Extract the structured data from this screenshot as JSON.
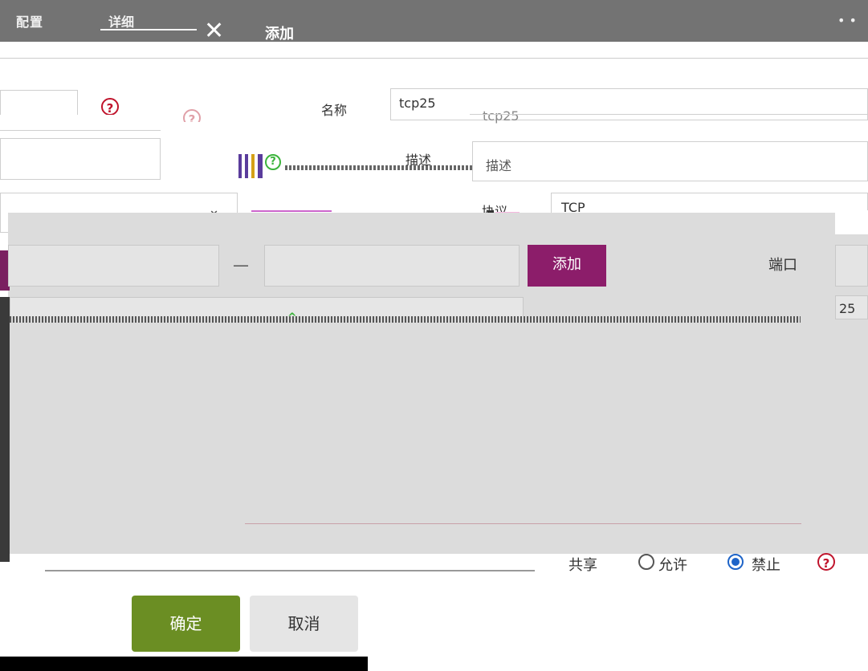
{
  "titlebar": {
    "tab_config": "配置",
    "tab_detail": "详细",
    "close_glyph": "✕",
    "tab_add": "添加",
    "dots": "• •"
  },
  "form": {
    "name_label": "名称",
    "name_value": "tcp25",
    "name_ghost": "tcp25",
    "desc_label": "描述",
    "desc_placeholder": "描述",
    "protocol_label": "协议",
    "protocol_value": "TCP",
    "chevron_glyph": "⌄",
    "help_glyph": "?"
  },
  "range": {
    "dash": "—",
    "add_label": "添加",
    "port_label": "端口",
    "list_item": "25"
  },
  "share": {
    "label": "共享",
    "allow_label": "允许",
    "deny_label": "禁止",
    "selected": "deny"
  },
  "actions": {
    "ok_label": "确定",
    "cancel_label": "取消"
  },
  "colors": {
    "accent": "#8c1d6a",
    "ok": "#6b8e23",
    "help": "#c0142c"
  }
}
